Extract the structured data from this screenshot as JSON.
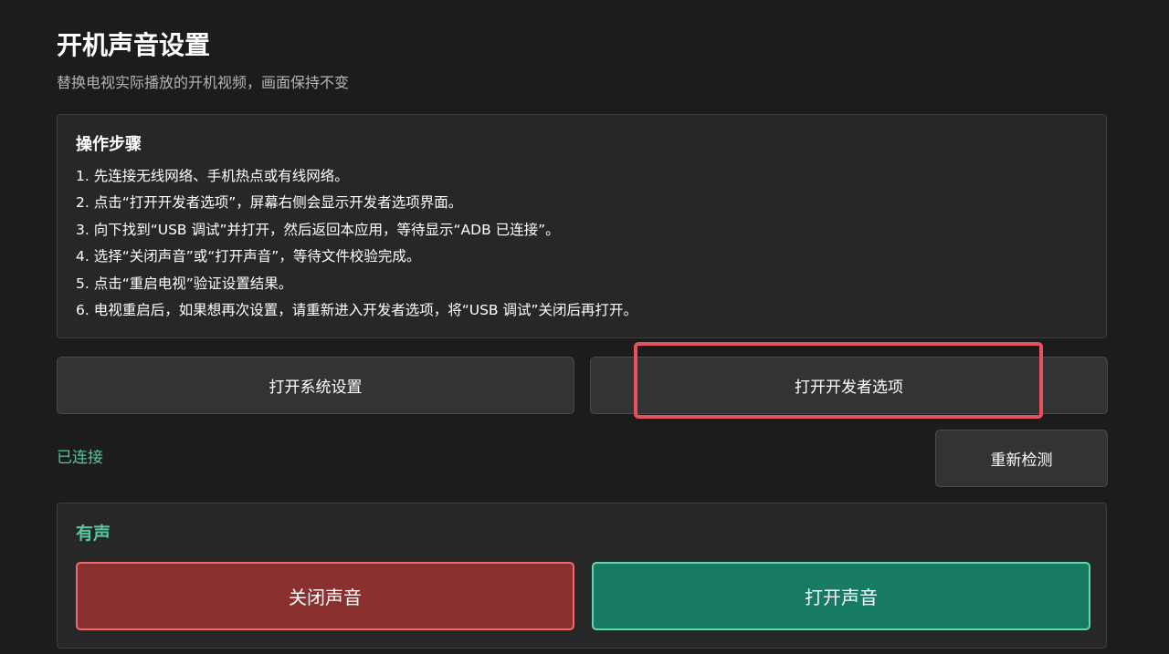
{
  "header": {
    "title": "开机声音设置",
    "subtitle": "替换电视实际播放的开机视频，画面保持不变"
  },
  "steps": {
    "heading": "操作步骤",
    "items": [
      "1. 先连接无线网络、手机热点或有线网络。",
      "2. 点击“打开开发者选项”，屏幕右侧会显示开发者选项界面。",
      "3. 向下找到“USB 调试”并打开，然后返回本应用，等待显示“ADB 已连接”。",
      "4. 选择“关闭声音”或“打开声音”，等待文件校验完成。",
      "5. 点击“重启电视”验证设置结果。",
      "6. 电视重启后，如果想再次设置，请重新进入开发者选项，将“USB 调试”关闭后再打开。"
    ]
  },
  "actions": {
    "open_system_settings": "打开系统设置",
    "open_developer_options": "打开开发者选项"
  },
  "connection": {
    "status": "已连接",
    "recheck": "重新检测"
  },
  "sound": {
    "state": "有声",
    "mute_label": "关闭声音",
    "unmute_label": "打开声音"
  },
  "colors": {
    "background": "#1c1c1c",
    "card": "#272727",
    "accent_green": "#57c5a0",
    "mute_red": "#8b3030",
    "unmute_green": "#177b63",
    "highlight": "#e8505f"
  }
}
